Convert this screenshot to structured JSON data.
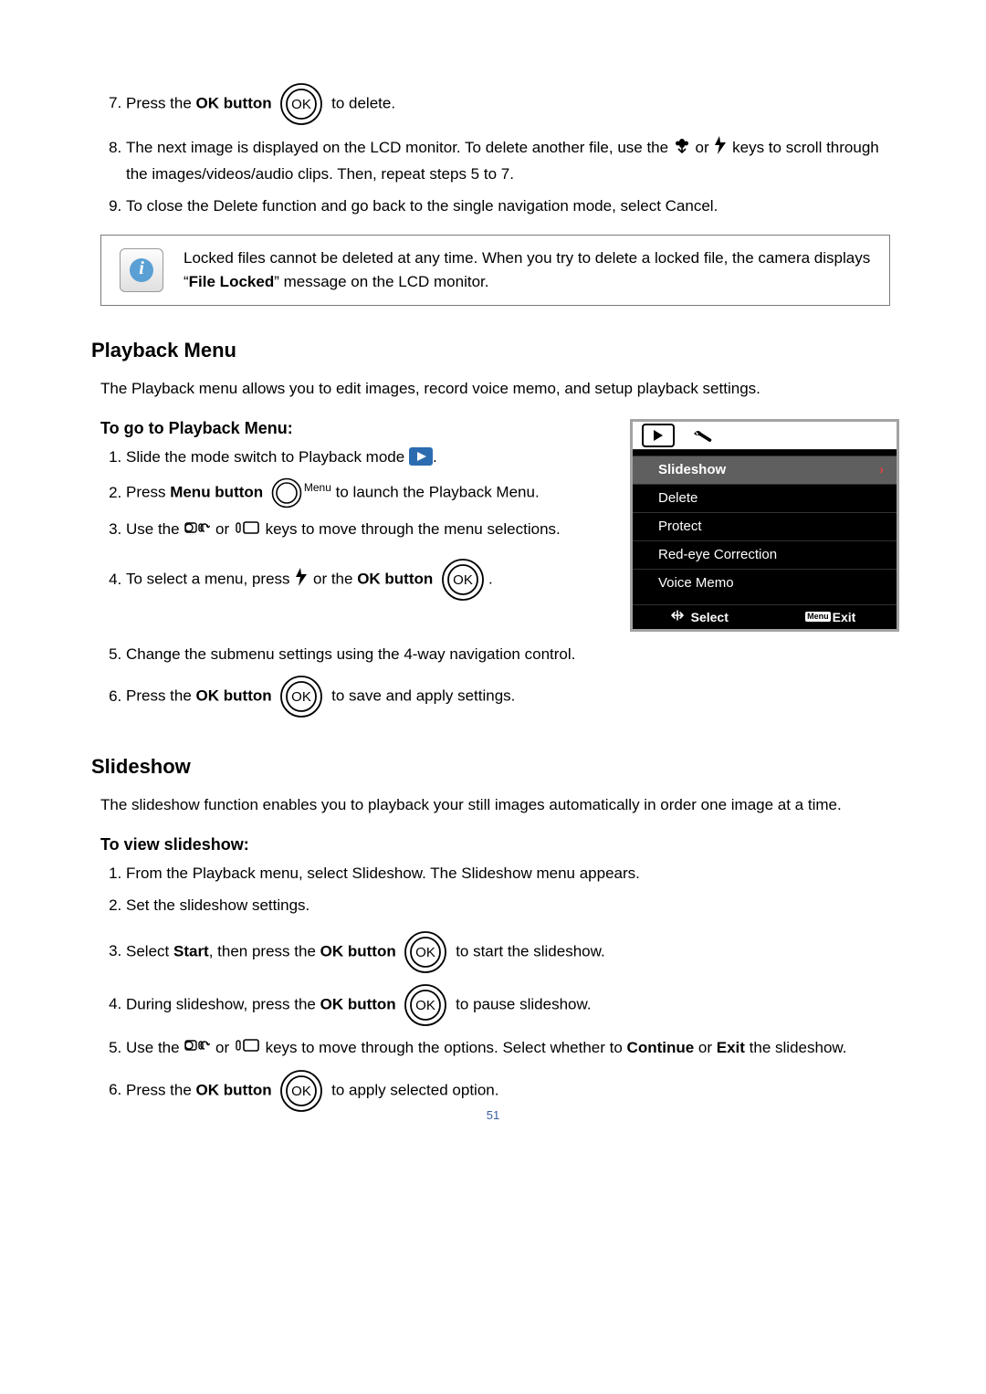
{
  "step7": {
    "prefix": "Press the ",
    "bold": "OK button",
    "suffix": " to delete."
  },
  "step8": {
    "prefix": "The next image is displayed on the LCD monitor. To delete another file, use the ",
    "mid": " or ",
    "suffix": " keys to scroll through the images/videos/audio clips. Then, repeat steps 5 to 7."
  },
  "step9": "To close the Delete function and go back to the single navigation mode, select Cancel.",
  "note": {
    "line1": "Locked files cannot be deleted at any time. When you try to delete a locked file, the camera displays “",
    "bold": "File Locked",
    "line2": "” message on the LCD monitor."
  },
  "playback_menu_heading": "Playback Menu",
  "playback_menu_intro": "The Playback menu allows you to edit images, record voice memo, and setup playback settings.",
  "to_go_heading": "To go to Playback Menu:",
  "pb1": {
    "text": "Slide the mode switch to Playback mode "
  },
  "pb2": {
    "prefix": "Press ",
    "bold": "Menu button",
    "menu_label": "Menu",
    "suffix": " to launch the Playback Menu."
  },
  "pb3": {
    "prefix": "Use the ",
    "mid": " or ",
    "suffix": " keys to move through the menu selections."
  },
  "pb4": {
    "prefix": "To select a menu, press ",
    "mid": " or the ",
    "bold": "OK button",
    "suffix": "."
  },
  "pb5": "Change the submenu settings using the 4-way navigation control.",
  "pb6": {
    "prefix": "Press the ",
    "bold": "OK button",
    "suffix": " to save and apply settings."
  },
  "camera_ui": {
    "rows": [
      "Slideshow",
      "Delete",
      "Protect",
      "Red-eye Correction",
      "Voice Memo"
    ],
    "select": "Select",
    "menu_tag": "Menu",
    "exit": "Exit"
  },
  "slideshow_heading": "Slideshow",
  "slideshow_intro": "The slideshow function enables you to playback your still images automatically in order one image at a time.",
  "to_view_heading": "To view slideshow:",
  "ss1": "From the Playback menu, select Slideshow. The Slideshow menu appears.",
  "ss2": "Set the slideshow settings.",
  "ss3": {
    "prefix": "Select ",
    "bold1": "Start",
    "mid": ", then press the ",
    "bold2": "OK button",
    "suffix": " to start the slideshow."
  },
  "ss4": {
    "prefix": "During slideshow, press the ",
    "bold": "OK button",
    "suffix": " to pause slideshow."
  },
  "ss5": {
    "prefix": "Use the ",
    "mid1": " or ",
    "mid2": " keys to move through the options. Select whether to ",
    "bold1": "Continue",
    "mid3": " or ",
    "bold2": "Exit",
    "suffix": " the slideshow."
  },
  "ss6": {
    "prefix": "Press the ",
    "bold": "OK button",
    "suffix": " to apply selected option."
  },
  "page_number": "51"
}
